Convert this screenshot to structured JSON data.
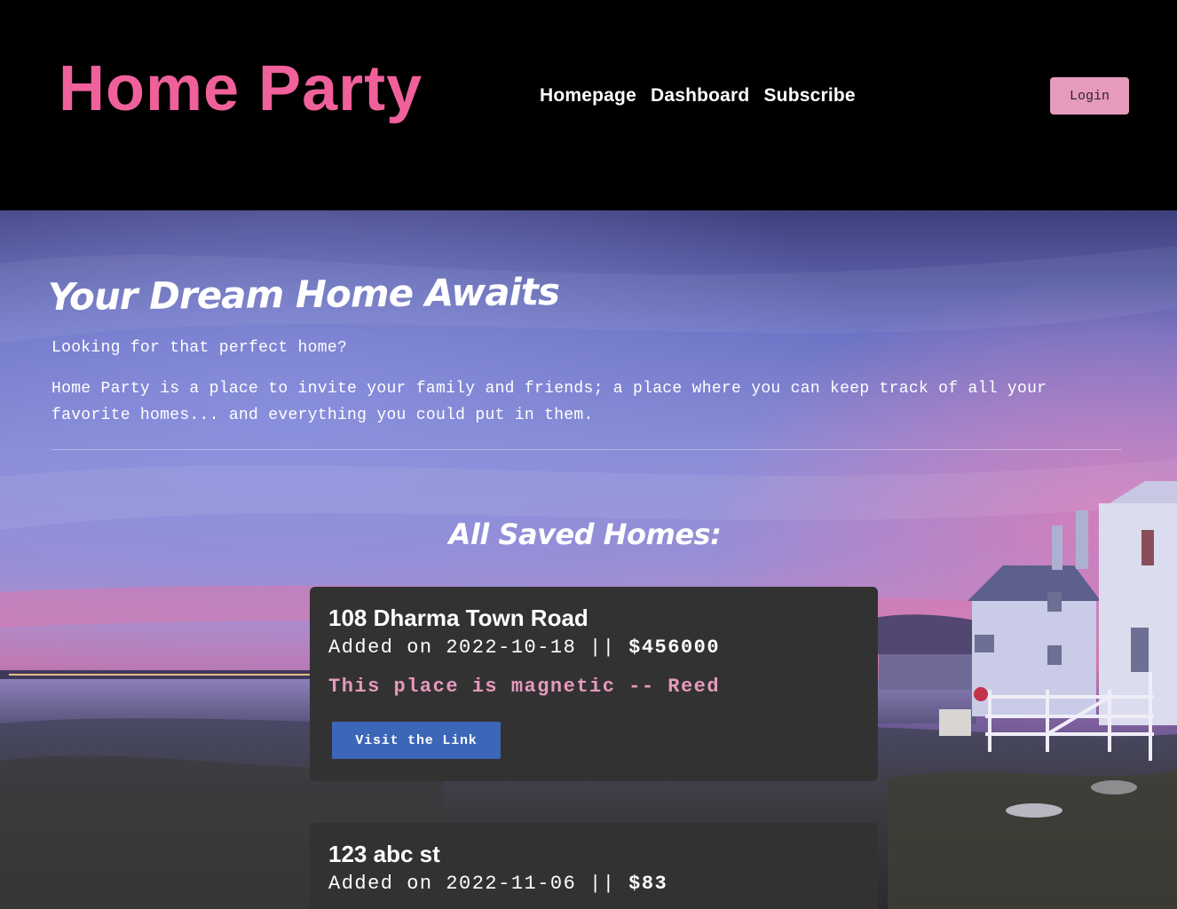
{
  "header": {
    "brand": "Home Party",
    "nav": [
      "Homepage",
      "Dashboard",
      "Subscribe"
    ],
    "login_label": "Login"
  },
  "hero": {
    "title": "Your Dream Home Awaits",
    "lead": "Looking for that perfect home?",
    "description": "Home Party is a place to invite your family and friends; a place where you can keep track of all your favorite homes... and everything you could put in them."
  },
  "saved": {
    "title": "All Saved Homes:",
    "homes": [
      {
        "address": "108 Dharma Town Road",
        "added_prefix": "Added on 2022-10-18 ||",
        "price": "$456000",
        "note": "This place is magnetic -- Reed",
        "link_label": "Visit the Link"
      },
      {
        "address": "123 abc st",
        "added_prefix": "Added on 2022-11-06 ||",
        "price": "$83"
      }
    ]
  },
  "colors": {
    "brand": "#f0609a",
    "login_bg": "#e69abd",
    "card_bg": "#333233",
    "quote": "#e69abd",
    "link_button": "#3c66b8"
  }
}
